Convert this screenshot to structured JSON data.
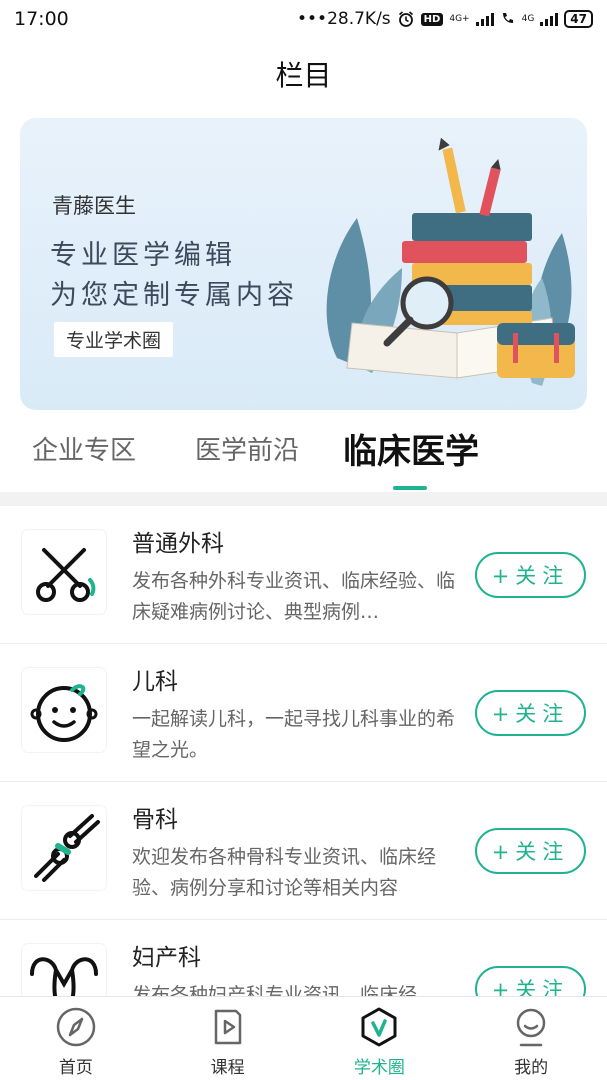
{
  "status_bar": {
    "time": "17:00",
    "network_speed": "•••28.7K/s",
    "hd": "HD",
    "signal1_label": "4G+",
    "signal2_label": "4G",
    "battery": "47"
  },
  "header": {
    "title": "栏目"
  },
  "banner": {
    "brand": "青藤医生",
    "line1": "专业医学编辑",
    "line2": "为您定制专属内容",
    "tag": "专业学术圈"
  },
  "tabs": [
    {
      "label": "企业专区",
      "active": false
    },
    {
      "label": "医学前沿",
      "active": false
    },
    {
      "label": "临床医学",
      "active": true
    }
  ],
  "items": [
    {
      "title": "普通外科",
      "desc": "发布各种外科专业资讯、临床经验、临床疑难病例讨论、典型病例…",
      "icon": "scissors-icon",
      "button": "+关注"
    },
    {
      "title": "儿科",
      "desc": "一起解读儿科，一起寻找儿科事业的希望之光。",
      "icon": "baby-face-icon",
      "button": "+关注"
    },
    {
      "title": "骨科",
      "desc": "欢迎发布各种骨科专业资讯、临床经验、病例分享和讨论等相关内容",
      "icon": "bone-joint-icon",
      "button": "+关注"
    },
    {
      "title": "妇产科",
      "desc": "发布各种妇产科专业资讯、临床经",
      "icon": "uterus-icon",
      "button": "+关注"
    }
  ],
  "bottom_nav": [
    {
      "label": "首页",
      "icon": "compass-icon",
      "active": false
    },
    {
      "label": "课程",
      "icon": "course-play-icon",
      "active": false
    },
    {
      "label": "学术圈",
      "icon": "academic-circle-icon",
      "active": true
    },
    {
      "label": "我的",
      "icon": "profile-icon",
      "active": false
    }
  ],
  "colors": {
    "accent": "#1fb38f",
    "text": "#222222",
    "muted": "#666666"
  }
}
